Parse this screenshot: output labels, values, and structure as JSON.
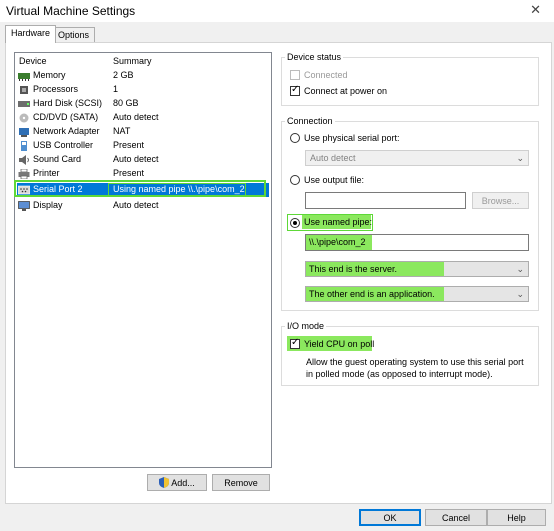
{
  "window": {
    "title": "Virtual Machine Settings",
    "close_glyph": "✕"
  },
  "tabs": [
    {
      "label": "Hardware",
      "active": true
    },
    {
      "label": "Options",
      "active": false
    }
  ],
  "device_list": {
    "headers": {
      "device": "Device",
      "summary": "Summary"
    },
    "devices": [
      {
        "name": "Memory",
        "summary": "2 GB",
        "icon": "memory-icon"
      },
      {
        "name": "Processors",
        "summary": "1",
        "icon": "processor-icon"
      },
      {
        "name": "Hard Disk (SCSI)",
        "summary": "80 GB",
        "icon": "hard-disk-icon"
      },
      {
        "name": "CD/DVD (SATA)",
        "summary": "Auto detect",
        "icon": "cd-dvd-icon"
      },
      {
        "name": "Network Adapter",
        "summary": "NAT",
        "icon": "network-adapter-icon"
      },
      {
        "name": "USB Controller",
        "summary": "Present",
        "icon": "usb-icon"
      },
      {
        "name": "Sound Card",
        "summary": "Auto detect",
        "icon": "sound-card-icon"
      },
      {
        "name": "Printer",
        "summary": "Present",
        "icon": "printer-icon"
      },
      {
        "name": "Serial Port 2",
        "summary": "Using named pipe \\\\.\\pipe\\com_2",
        "icon": "serial-port-icon",
        "selected": true
      },
      {
        "name": "Display",
        "summary": "Auto detect",
        "icon": "display-icon"
      }
    ]
  },
  "list_buttons": {
    "add": "Add...",
    "remove": "Remove"
  },
  "device_status": {
    "title": "Device status",
    "connected": {
      "label": "Connected",
      "checked": false,
      "disabled": true
    },
    "connect_at_power_on": {
      "label": "Connect at power on",
      "checked": true
    }
  },
  "connection": {
    "title": "Connection",
    "physical": {
      "label": "Use physical serial port:",
      "selected": false,
      "dropdown": "Auto detect"
    },
    "output_file": {
      "label": "Use output file:",
      "selected": false,
      "value": "",
      "browse": "Browse..."
    },
    "named_pipe": {
      "label": "Use named pipe:",
      "selected": true,
      "value": "\\\\.\\pipe\\com_2",
      "end_select": "This end is the server.",
      "other_select": "The other end is an application."
    }
  },
  "io_mode": {
    "title": "I/O mode",
    "yield": {
      "label": "Yield CPU on poll",
      "checked": true
    },
    "description": "Allow the guest operating system to use this serial port in polled mode (as opposed to interrupt mode)."
  },
  "footer": {
    "ok": "OK",
    "cancel": "Cancel",
    "help": "Help"
  },
  "colors": {
    "selection": "#0078d7",
    "highlight": "#8be85e"
  }
}
